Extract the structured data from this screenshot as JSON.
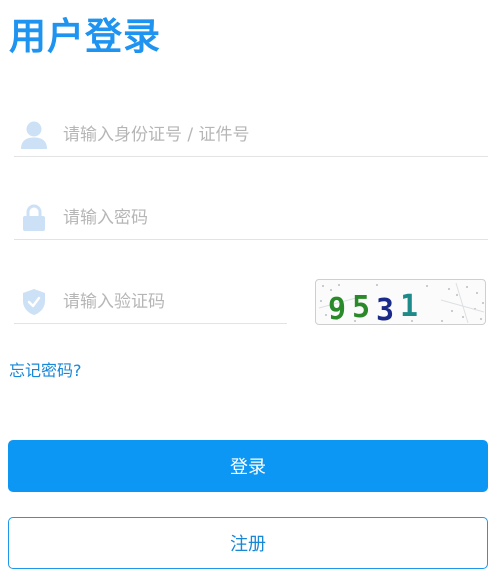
{
  "page": {
    "title": "用户登录"
  },
  "form": {
    "id_placeholder": "请输入身份证号 / 证件号",
    "password_placeholder": "请输入密码",
    "captcha_placeholder": "请输入验证码",
    "captcha_text": "9531",
    "forgot_label": "忘记密码?",
    "login_label": "登录",
    "register_label": "注册"
  },
  "icons": {
    "user": "user-icon",
    "lock": "lock-icon",
    "shield": "shield-icon"
  },
  "colors": {
    "accent": "#1e93f0",
    "button": "#0c97f5",
    "icon": "#cde1f6",
    "link": "#1787d8"
  }
}
